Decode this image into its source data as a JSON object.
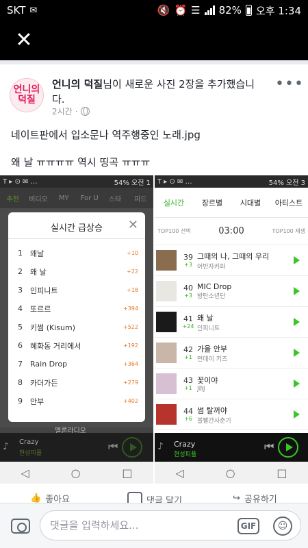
{
  "status_bar": {
    "carrier": "SKT",
    "battery": "82%",
    "time": "오후 1:34",
    "voice": "Voice"
  },
  "viewer": {
    "close_icon": "close-icon"
  },
  "post": {
    "author": "언니의 덕질",
    "action": "님이 새로운 사진 2장을 추가했습니다.",
    "avatar_text": [
      "언니의",
      "덕질"
    ],
    "time": "2시간",
    "privacy_icon": "globe-icon",
    "more_icon": "more-dots-icon",
    "caption_line1": "네이트판에서 입소문나 역주행중인 노래.jpg",
    "caption_line2": "왜 날 ㅠㅠㅠㅠ 역시 띵곡 ㅠㅠㅠ"
  },
  "left_screenshot": {
    "status": "54% 오전 1",
    "tabs": [
      "추천",
      "비디오",
      "MY",
      "For U",
      "스타",
      "피드"
    ],
    "popup_title": "실시간 급상승",
    "ranking": [
      {
        "rank": "1",
        "title": "왜날",
        "delta": "+10"
      },
      {
        "rank": "2",
        "title": "왜 날",
        "delta": "+22"
      },
      {
        "rank": "3",
        "title": "인피니트",
        "delta": "+18"
      },
      {
        "rank": "4",
        "title": "또르르",
        "delta": "+394"
      },
      {
        "rank": "5",
        "title": "키썸 (Kisum)",
        "delta": "+522"
      },
      {
        "rank": "6",
        "title": "혜화동 거리에서",
        "delta": "+192"
      },
      {
        "rank": "7",
        "title": "Rain Drop",
        "delta": "+364"
      },
      {
        "rank": "8",
        "title": "카더가든",
        "delta": "+279"
      },
      {
        "rank": "9",
        "title": "안부",
        "delta": "+402"
      }
    ],
    "bottom_label": "멜론라디오",
    "player_title": "Crazy",
    "player_artist": "현성피플"
  },
  "right_screenshot": {
    "status": "54% 오전 3",
    "tabs": [
      "실시간",
      "장르별",
      "시대별",
      "아티스트"
    ],
    "sub_left": "TOP100 선택",
    "sub_time": "03:00",
    "sub_right": "TOP100 재생",
    "songs": [
      {
        "rank": "39",
        "change": "+3",
        "title": "그때의 나, 그때의 우리",
        "artist": "어반자카파",
        "cover": "#8a6d4e"
      },
      {
        "rank": "40",
        "change": "+3",
        "title": "MIC Drop",
        "artist": "방탄소년단",
        "cover": "#e9e7e2"
      },
      {
        "rank": "41",
        "change": "+24",
        "title": "왜 날",
        "artist": "인피니트",
        "cover": "#1a1a1a"
      },
      {
        "rank": "42",
        "change": "+1",
        "title": "가을 안부",
        "artist": "먼데이 키즈",
        "cover": "#c9b6a8"
      },
      {
        "rank": "43",
        "change": "+1",
        "title": "꽃이야",
        "artist": "JBJ",
        "cover": "#d8c0d3"
      },
      {
        "rank": "44",
        "change": "+6",
        "title": "썸 탈꺼야",
        "artist": "볼빨간사춘기",
        "cover": "#b6342c"
      }
    ],
    "player_title": "Crazy",
    "player_artist": "현성피플"
  },
  "actions": {
    "like": "좋아요",
    "comment": "댓글 달기",
    "share": "공유하기"
  },
  "comment_bar": {
    "placeholder": "댓글을 입력하세요...",
    "gif_label": "GIF"
  }
}
